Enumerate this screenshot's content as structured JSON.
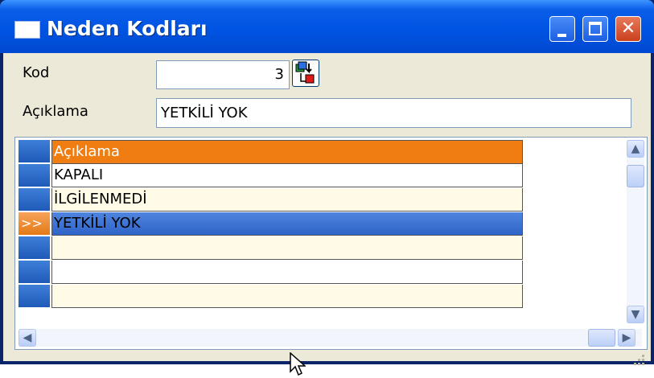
{
  "window": {
    "title": "Neden Kodları"
  },
  "form": {
    "kod_label": "Kod",
    "kod_value": "3",
    "aciklama_label": "Açıklama",
    "aciklama_value": "YETKİLİ YOK"
  },
  "grid": {
    "header": "Açıklama",
    "current_marker": ">>",
    "rows": [
      "KAPALI",
      "İLGİLENMEDİ",
      "YETKİLİ YOK",
      "",
      "",
      ""
    ],
    "selected_row": 2
  },
  "colors": {
    "header": "#ef7d11",
    "selected": "#3a6fd4",
    "indicator": "#2a65c4",
    "titlebar": "#0054e3"
  },
  "icons": {
    "lookup": "lookup-icon",
    "close": "close-icon",
    "minimize": "minimize-icon",
    "maximize": "maximize-icon"
  }
}
